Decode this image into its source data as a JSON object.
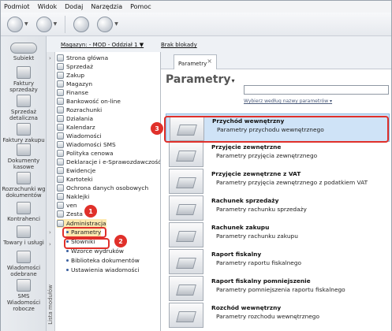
{
  "menu": [
    "Podmiot",
    "Widok",
    "Dodaj",
    "Narzędzia",
    "Pomoc"
  ],
  "toolbar": {
    "subiekt_label": "Subiekt"
  },
  "topbar": {
    "magazyn": "Magazyn: - MOD - Oddział 1",
    "blokady": "Brak blokady"
  },
  "bignav": [
    "Faktury\nsprzedaży",
    "Sprzedaż\ndetaliczna",
    "Faktury zakupu",
    "Dokumenty\nkasowe",
    "Rozrachunki wg\ndokumentów",
    "Kontrahenci",
    "Towary i usługi",
    "Wiadomości\nodebrane",
    "SMS\nWiadomości\nrobocze"
  ],
  "vtab_label": "Lista modułów",
  "tree": [
    "Strona główna",
    "Sprzedaż",
    "Zakup",
    "Magazyn",
    "Finanse",
    "Bankowość on-line",
    "Rozrachunki",
    "Działania",
    "Kalendarz",
    "Wiadomości",
    "Wiadomości SMS",
    "Polityka cenowa",
    "Deklaracje i e-Sprawozdawczość",
    "Ewidencje",
    "Kartoteki",
    "Ochrona danych osobowych",
    "Naklejki",
    "ven",
    "Zesta",
    "Administracja"
  ],
  "tree_sub": [
    "Parametry",
    "Słowniki",
    "Wzorce wydruków",
    "Biblioteka dokumentów",
    "Ustawienia wiadomości"
  ],
  "tab": {
    "label": "Parametry",
    "close": "×"
  },
  "panel": {
    "title": "Parametry",
    "filter_link": "Wybierz według nazwy parametrów"
  },
  "items": [
    {
      "title": "Przychód wewnętrzny",
      "desc": "Parametry przychodu wewnętrznego"
    },
    {
      "title": "Przyjęcie zewnętrzne",
      "desc": "Parametry przyjęcia zewnętrznego"
    },
    {
      "title": "Przyjęcie zewnętrzne z VAT",
      "desc": "Parametry przyjęcia zewnętrznego z podatkiem VAT"
    },
    {
      "title": "Rachunek sprzedaży",
      "desc": "Parametry rachunku sprzedaży"
    },
    {
      "title": "Rachunek zakupu",
      "desc": "Parametry rachunku zakupu"
    },
    {
      "title": "Raport fiskalny",
      "desc": "Parametry raportu fiskalnego"
    },
    {
      "title": "Raport fiskalny pomniejszenie",
      "desc": "Parametry pomniejszenia raportu fiskalnego"
    },
    {
      "title": "Rozchód wewnętrzny",
      "desc": "Parametry rozchodu wewnętrznego"
    }
  ],
  "badges": [
    "1",
    "2",
    "3"
  ]
}
